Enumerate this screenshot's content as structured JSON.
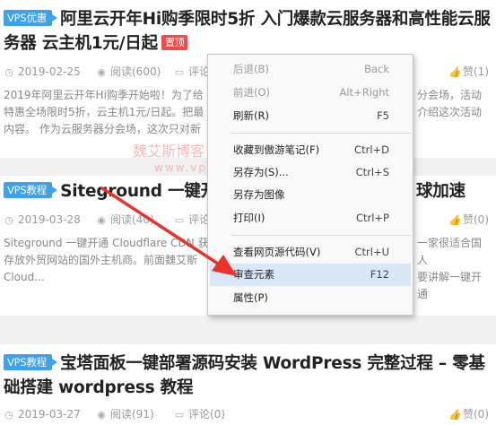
{
  "posts": [
    {
      "tag": "VPS优惠",
      "title": "阿里云开年Hi购季限时5折 入门爆款云服务器和高性能云服务器 云主机1元/日起",
      "top_badge": "置顶",
      "date": "2019-02-25",
      "views": "阅读(600)",
      "comments": "评论",
      "likes": "赞(1)",
      "excerpt": [
        "2019年阿里云开年Hi购季开始啦！为了给",
        "特惠全场限时5折，云主机1元/日起。把最",
        "内容。 作为云服务器分会场，这次只对新"
      ],
      "excerpt_right": [
        "分会场，活动",
        "介绍这次活动",
        ""
      ]
    },
    {
      "tag": "VPS教程",
      "title_left": "Siteground 一键开",
      "title_right": "球加速",
      "date": "2019-03-28",
      "views": "阅读(40)",
      "comments": "评论",
      "likes": "赞(0)",
      "excerpt": [
        "Siteground 一键开通 Cloudflare CDN 获",
        "存放外贸网站的国外主机商。前面魏艾斯",
        "Cloud..."
      ],
      "excerpt_right": [
        "一家很适合国人",
        "要讲解一键开通",
        ""
      ]
    },
    {
      "tag": "VPS教程",
      "title": "宝塔面板一键部署源码安装 WordPress 完整过程 – 零基础搭建 wordpress 教程",
      "date": "2019-03-27",
      "views": "阅读(91)",
      "comments": "评论(0)",
      "likes": "赞(0)"
    }
  ],
  "watermark": {
    "name": "魏艾斯博客",
    "url": "www.vpsss.net"
  },
  "context_menu": [
    {
      "label": "后退(B)",
      "shortcut": "Back",
      "disabled": true
    },
    {
      "label": "前进(O)",
      "shortcut": "Alt+Right",
      "disabled": true
    },
    {
      "label": "刷新(R)",
      "shortcut": "F5",
      "disabled": false
    },
    {
      "label": "收藏到傲游笔记(F)",
      "shortcut": "Ctrl+D",
      "disabled": false
    },
    {
      "label": "另存为(S)...",
      "shortcut": "Ctrl+S",
      "disabled": false
    },
    {
      "label": "另存为图像",
      "shortcut": "",
      "disabled": false
    },
    {
      "label": "打印(I)",
      "shortcut": "Ctrl+P",
      "disabled": false
    },
    {
      "label": "查看网页源代码(V)",
      "shortcut": "Ctrl+U",
      "disabled": false
    },
    {
      "label": "审查元素",
      "shortcut": "F12",
      "disabled": false,
      "highlighted": true
    },
    {
      "label": "属性(P)",
      "shortcut": "",
      "disabled": false
    }
  ],
  "colors": {
    "tag": "#3fa1e8",
    "top_badge": "#f04a49",
    "arrow": "#e8322a",
    "highlight": "#d9e7f7"
  },
  "icons": {
    "date": "clock-icon",
    "views": "eye-icon",
    "comments": "comment-icon",
    "likes": "thumbs-up-icon"
  }
}
